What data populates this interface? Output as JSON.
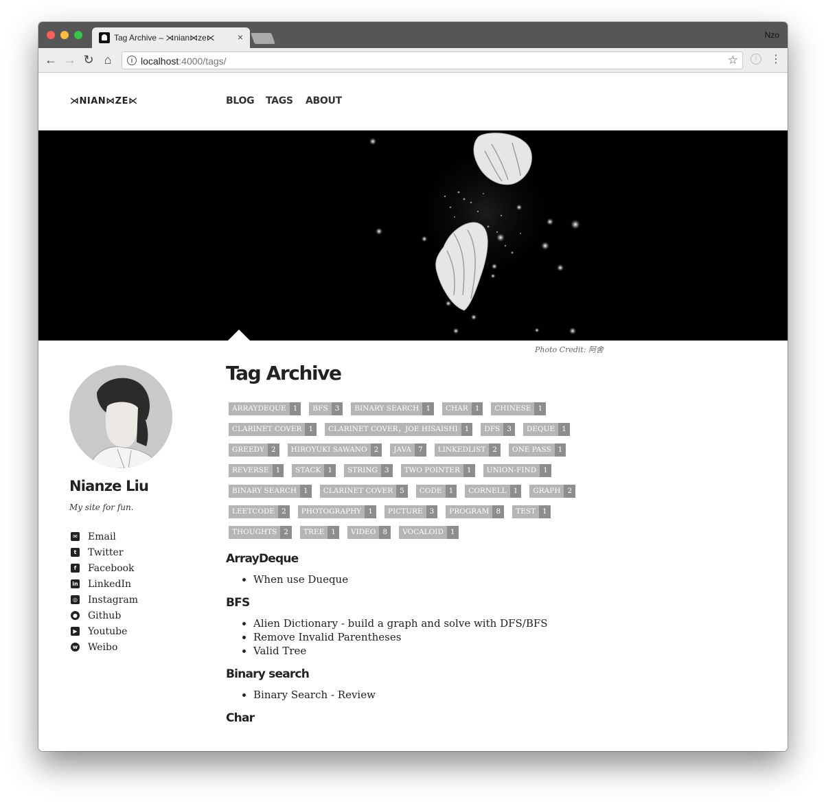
{
  "browser": {
    "tab_title": "Tag Archive – ⋊nian⋈ze⋉",
    "tab_close": "×",
    "profile": "Nzo",
    "url_host": "localhost",
    "url_rest": ":4000/tags/",
    "icons": [
      "back-arrow-icon",
      "forward-arrow-icon",
      "reload-icon",
      "home-icon",
      "info-icon",
      "star-icon",
      "extension-icon",
      "menu-icon"
    ]
  },
  "site": {
    "title": "⋊NIAN⋈ZE⋉",
    "nav": {
      "blog": "BLOG",
      "tags": "TAGS",
      "about": "ABOUT"
    },
    "photo_credit": "Photo Credit: 阿舍"
  },
  "author": {
    "name": "Nianze Liu",
    "bio": "My site for fun.",
    "links": [
      {
        "label": "Email",
        "icon": "envelope-icon"
      },
      {
        "label": "Twitter",
        "icon": "twitter-icon"
      },
      {
        "label": "Facebook",
        "icon": "facebook-icon"
      },
      {
        "label": "LinkedIn",
        "icon": "linkedin-icon"
      },
      {
        "label": "Instagram",
        "icon": "instagram-icon"
      },
      {
        "label": "Github",
        "icon": "github-icon"
      },
      {
        "label": "Youtube",
        "icon": "youtube-icon"
      },
      {
        "label": "Weibo",
        "icon": "weibo-icon"
      }
    ]
  },
  "content": {
    "title": "Tag Archive",
    "tags": [
      {
        "name": "ArrayDeque",
        "count": "1"
      },
      {
        "name": "BFS",
        "count": "3"
      },
      {
        "name": "Binary search",
        "count": "1"
      },
      {
        "name": "Char",
        "count": "1"
      },
      {
        "name": "Chinese",
        "count": "1"
      },
      {
        "name": "Clarinet cover",
        "count": "1"
      },
      {
        "name": "Clarinet cover，Joe Hisaishi",
        "count": "1"
      },
      {
        "name": "DFS",
        "count": "3"
      },
      {
        "name": "Deque",
        "count": "1"
      },
      {
        "name": "Greedy",
        "count": "2"
      },
      {
        "name": "Hiroyuki Sawano",
        "count": "2"
      },
      {
        "name": "Java",
        "count": "7"
      },
      {
        "name": "LinkedList",
        "count": "2"
      },
      {
        "name": "One pass",
        "count": "1"
      },
      {
        "name": "Reverse",
        "count": "1"
      },
      {
        "name": "Stack",
        "count": "1"
      },
      {
        "name": "String",
        "count": "3"
      },
      {
        "name": "Two Pointer",
        "count": "1"
      },
      {
        "name": "Union-Find",
        "count": "1"
      },
      {
        "name": "binary search",
        "count": "1"
      },
      {
        "name": "clarinet cover",
        "count": "5"
      },
      {
        "name": "code",
        "count": "1"
      },
      {
        "name": "cornell",
        "count": "1"
      },
      {
        "name": "graph",
        "count": "2"
      },
      {
        "name": "leetcode",
        "count": "2"
      },
      {
        "name": "photography",
        "count": "1"
      },
      {
        "name": "picture",
        "count": "3"
      },
      {
        "name": "program",
        "count": "8"
      },
      {
        "name": "test",
        "count": "1"
      },
      {
        "name": "thoughts",
        "count": "2"
      },
      {
        "name": "tree",
        "count": "1"
      },
      {
        "name": "video",
        "count": "8"
      },
      {
        "name": "vocaloid",
        "count": "1"
      }
    ],
    "sections": [
      {
        "heading": "ArrayDeque",
        "items": [
          "When use Dueque"
        ]
      },
      {
        "heading": "BFS",
        "items": [
          "Alien Dictionary - build a graph and solve with DFS/BFS",
          "Remove Invalid Parentheses",
          "Valid Tree"
        ]
      },
      {
        "heading": "Binary search",
        "items": [
          "Binary Search - Review"
        ]
      },
      {
        "heading": "Char",
        "items": []
      }
    ]
  }
}
